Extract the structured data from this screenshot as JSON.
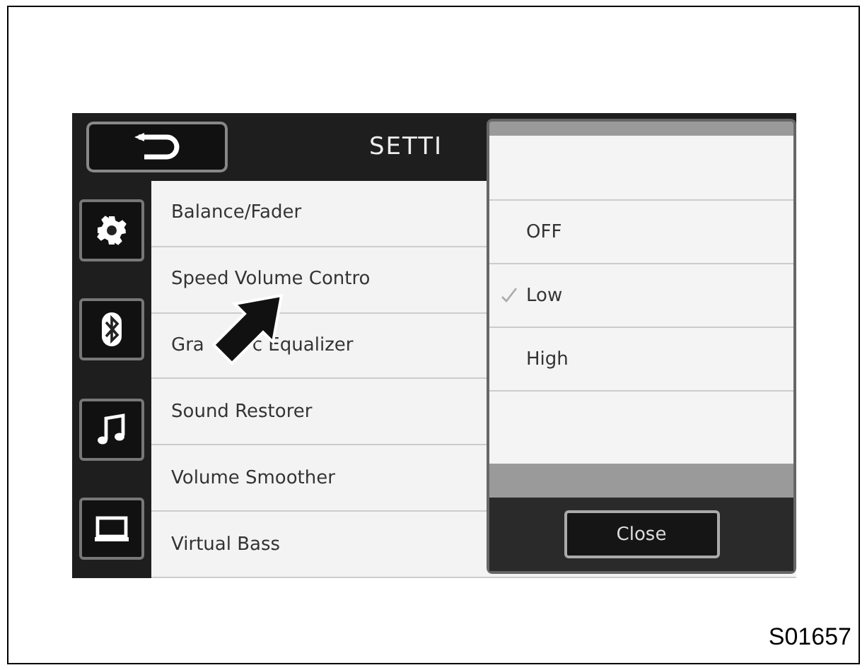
{
  "header": {
    "title": "SETTI"
  },
  "sidebar": [
    {
      "kind": "gear"
    },
    {
      "kind": "bluetooth"
    },
    {
      "kind": "music"
    },
    {
      "kind": "screen"
    }
  ],
  "menu_items": [
    {
      "parts": [
        "Balance/Fader"
      ]
    },
    {
      "parts": [
        "Speed Volume Contro"
      ]
    },
    {
      "parts": [
        "Gra",
        "c Equalizer"
      ]
    },
    {
      "parts": [
        "Sound Restorer"
      ]
    },
    {
      "parts": [
        "Volume Smoother"
      ]
    },
    {
      "parts": [
        "Virtual Bass"
      ]
    }
  ],
  "popup": {
    "options": [
      {
        "label": "OFF",
        "selected": false
      },
      {
        "label": "Low",
        "selected": true
      },
      {
        "label": "High",
        "selected": false
      }
    ],
    "close_button": "Close"
  },
  "figure_code": "S01657"
}
